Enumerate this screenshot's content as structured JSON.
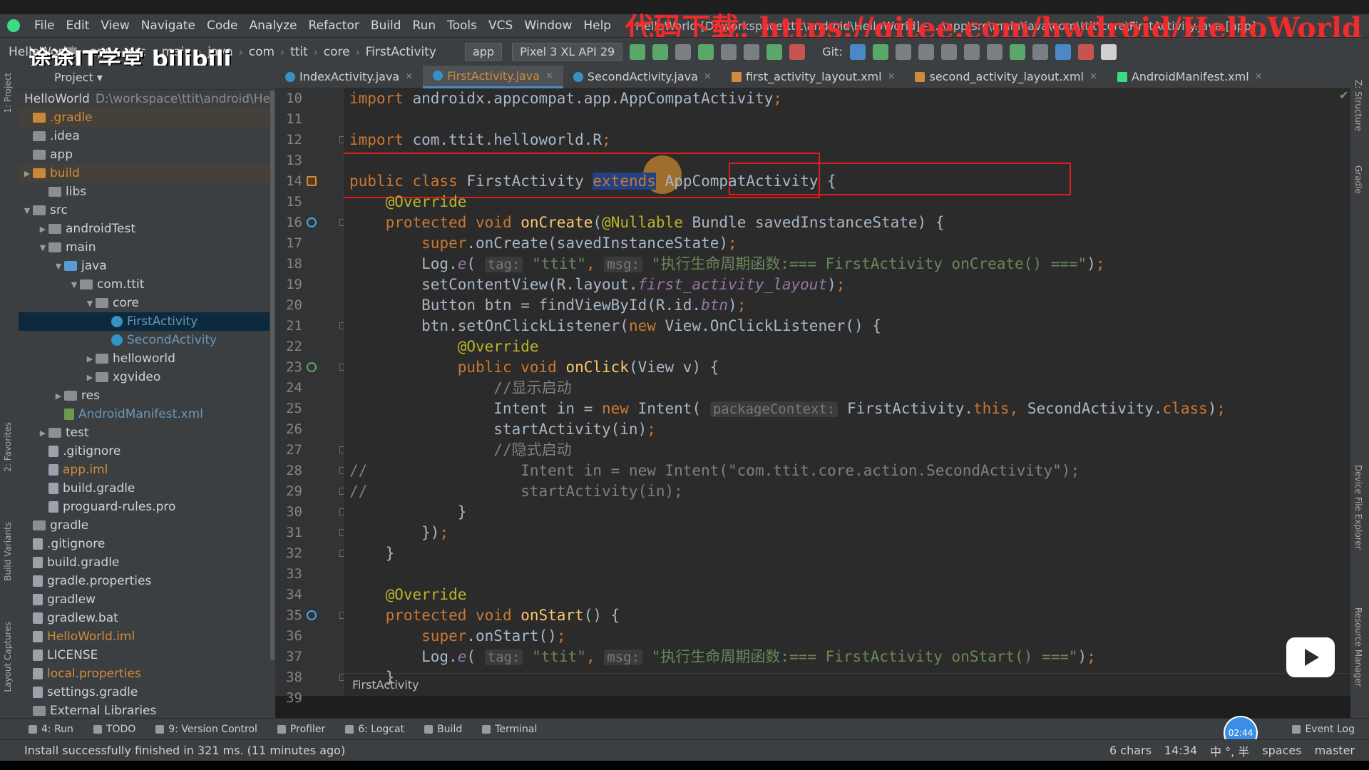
{
  "menu": {
    "items": [
      "File",
      "Edit",
      "View",
      "Navigate",
      "Code",
      "Analyze",
      "Refactor",
      "Build",
      "Run",
      "Tools",
      "VCS",
      "Window",
      "Help"
    ],
    "title": "HelloWorld [D:\\workspace\\ttit\\android\\HelloWorld] - ...\\app\\src\\main\\java\\com\\ttit\\core\\FirstActivity.java [app]"
  },
  "watermarks": {
    "url": "代码下载: https://gitee.com/hwdroid/HelloWorld",
    "brand": "途途IT学堂 bilibili"
  },
  "nav": {
    "crumbs": [
      "HelloWorld",
      "app",
      "src",
      "main",
      "java",
      "com",
      "ttit",
      "core",
      "FirstActivity"
    ],
    "run_config": "app",
    "device": "Pixel 3 XL API 29",
    "git_label": "Git:"
  },
  "project": {
    "header": "1: Project",
    "root_name": "HelloWorld",
    "root_path": "D:\\workspace\\ttit\\android\\HelloWorld",
    "tree": [
      {
        "label": ".gradle",
        "depth": 0,
        "arrow": "",
        "icon": "folder-orange",
        "color": "orange",
        "excluded": true
      },
      {
        "label": ".idea",
        "depth": 0,
        "arrow": "",
        "icon": "folder"
      },
      {
        "label": "app",
        "depth": 0,
        "arrow": "",
        "icon": "folder"
      },
      {
        "label": "build",
        "depth": 0,
        "arrow": "▶",
        "icon": "folder-orange",
        "color": "orange",
        "excluded": true
      },
      {
        "label": "libs",
        "depth": 1,
        "arrow": "",
        "icon": "folder"
      },
      {
        "label": "src",
        "depth": 0,
        "arrow": "▼",
        "icon": "folder"
      },
      {
        "label": "androidTest",
        "depth": 1,
        "arrow": "▶",
        "icon": "folder"
      },
      {
        "label": "main",
        "depth": 1,
        "arrow": "▼",
        "icon": "folder"
      },
      {
        "label": "java",
        "depth": 2,
        "arrow": "▼",
        "icon": "folder-blue"
      },
      {
        "label": "com.ttit",
        "depth": 3,
        "arrow": "▼",
        "icon": "folder"
      },
      {
        "label": "core",
        "depth": 4,
        "arrow": "▼",
        "icon": "folder"
      },
      {
        "label": "FirstActivity",
        "depth": 5,
        "arrow": "",
        "icon": "java",
        "color": "blue",
        "selected": true
      },
      {
        "label": "SecondActivity",
        "depth": 5,
        "arrow": "",
        "icon": "java",
        "color": "blue"
      },
      {
        "label": "helloworld",
        "depth": 4,
        "arrow": "▶",
        "icon": "folder"
      },
      {
        "label": "xgvideo",
        "depth": 4,
        "arrow": "▶",
        "icon": "folder"
      },
      {
        "label": "res",
        "depth": 2,
        "arrow": "▶",
        "icon": "folder"
      },
      {
        "label": "AndroidManifest.xml",
        "depth": 2,
        "arrow": "",
        "icon": "xml",
        "color": "blue"
      },
      {
        "label": "test",
        "depth": 1,
        "arrow": "▶",
        "icon": "folder"
      },
      {
        "label": ".gitignore",
        "depth": 1,
        "arrow": "",
        "icon": "file"
      },
      {
        "label": "app.iml",
        "depth": 1,
        "arrow": "",
        "icon": "file",
        "color": "orange"
      },
      {
        "label": "build.gradle",
        "depth": 1,
        "arrow": "",
        "icon": "file"
      },
      {
        "label": "proguard-rules.pro",
        "depth": 1,
        "arrow": "",
        "icon": "file"
      },
      {
        "label": "gradle",
        "depth": 0,
        "arrow": "",
        "icon": "folder"
      },
      {
        "label": ".gitignore",
        "depth": 0,
        "arrow": "",
        "icon": "file"
      },
      {
        "label": "build.gradle",
        "depth": 0,
        "arrow": "",
        "icon": "file"
      },
      {
        "label": "gradle.properties",
        "depth": 0,
        "arrow": "",
        "icon": "file"
      },
      {
        "label": "gradlew",
        "depth": 0,
        "arrow": "",
        "icon": "file"
      },
      {
        "label": "gradlew.bat",
        "depth": 0,
        "arrow": "",
        "icon": "file"
      },
      {
        "label": "HelloWorld.iml",
        "depth": 0,
        "arrow": "",
        "icon": "file",
        "color": "orange"
      },
      {
        "label": "LICENSE",
        "depth": 0,
        "arrow": "",
        "icon": "file"
      },
      {
        "label": "local.properties",
        "depth": 0,
        "arrow": "",
        "icon": "file",
        "color": "orange"
      },
      {
        "label": "settings.gradle",
        "depth": 0,
        "arrow": "",
        "icon": "file"
      },
      {
        "label": "External Libraries",
        "depth": 0,
        "arrow": "",
        "icon": "folder"
      }
    ]
  },
  "tabs": [
    {
      "label": "IndexActivity.java",
      "icon": "java",
      "active": false
    },
    {
      "label": "FirstActivity.java",
      "icon": "java",
      "active": true
    },
    {
      "label": "SecondActivity.java",
      "icon": "java",
      "active": false
    },
    {
      "label": "first_activity_layout.xml",
      "icon": "xml",
      "active": false
    },
    {
      "label": "second_activity_layout.xml",
      "icon": "xml",
      "active": false
    },
    {
      "label": "AndroidManifest.xml",
      "icon": "manifest",
      "active": false
    }
  ],
  "editor": {
    "line_numbers": [
      "10",
      "11",
      "12",
      "13",
      "14",
      "15",
      "16",
      "17",
      "18",
      "19",
      "20",
      "21",
      "22",
      "23",
      "24",
      "25",
      "26",
      "27",
      "28",
      "29",
      "30",
      "31",
      "32",
      "33",
      "34",
      "35",
      "36",
      "37",
      "38",
      "39"
    ],
    "lines": [
      [
        {
          "t": "import ",
          "c": "kw"
        },
        {
          "t": "androidx.appcompat.app.AppCompatActivity"
        },
        {
          "t": ";",
          "c": "kw"
        }
      ],
      [],
      [
        {
          "t": "import ",
          "c": "kw"
        },
        {
          "t": "com.ttit.helloworld.R"
        },
        {
          "t": ";",
          "c": "kw"
        }
      ],
      [],
      [
        {
          "t": "public class ",
          "c": "kw"
        },
        {
          "t": "FirstActivity "
        },
        {
          "t": "extends",
          "c": "sel"
        },
        {
          "t": " AppCompatActivity {"
        }
      ],
      [
        {
          "t": "    "
        },
        {
          "t": "@Override",
          "c": "an"
        }
      ],
      [
        {
          "t": "    "
        },
        {
          "t": "protected void ",
          "c": "kw"
        },
        {
          "t": "onCreate",
          "c": "fn"
        },
        {
          "t": "("
        },
        {
          "t": "@Nullable",
          "c": "an"
        },
        {
          "t": " Bundle savedInstanceState) {"
        }
      ],
      [
        {
          "t": "        "
        },
        {
          "t": "super",
          "c": "kw"
        },
        {
          "t": ".onCreate(savedInstanceState)"
        },
        {
          "t": ";",
          "c": "kw"
        }
      ],
      [
        {
          "t": "        Log."
        },
        {
          "t": "e",
          "c": "st"
        },
        {
          "t": "( "
        },
        {
          "t": "tag:",
          "c": "hint"
        },
        {
          "t": " "
        },
        {
          "t": "\"ttit\"",
          "c": "str"
        },
        {
          "t": ", ",
          "c": "kw"
        },
        {
          "t": "msg:",
          "c": "hint"
        },
        {
          "t": " "
        },
        {
          "t": "\"执行生命周期函数:=== FirstActivity onCreate() ===\"",
          "c": "str"
        },
        {
          "t": ")"
        },
        {
          "t": ";",
          "c": "kw"
        }
      ],
      [
        {
          "t": "        setContentView(R.layout."
        },
        {
          "t": "first_activity_layout",
          "c": "st"
        },
        {
          "t": ")"
        },
        {
          "t": ";",
          "c": "kw"
        }
      ],
      [
        {
          "t": "        Button btn = findViewById(R.id."
        },
        {
          "t": "btn",
          "c": "st"
        },
        {
          "t": ")"
        },
        {
          "t": ";",
          "c": "kw"
        }
      ],
      [
        {
          "t": "        btn.setOnClickListener("
        },
        {
          "t": "new ",
          "c": "kw"
        },
        {
          "t": "View.OnClickListener() {"
        }
      ],
      [
        {
          "t": "            "
        },
        {
          "t": "@Override",
          "c": "an"
        }
      ],
      [
        {
          "t": "            "
        },
        {
          "t": "public void ",
          "c": "kw"
        },
        {
          "t": "onClick",
          "c": "fn"
        },
        {
          "t": "(View v) {"
        }
      ],
      [
        {
          "t": "                "
        },
        {
          "t": "//显示启动",
          "c": "cm"
        }
      ],
      [
        {
          "t": "                Intent in = "
        },
        {
          "t": "new ",
          "c": "kw"
        },
        {
          "t": "Intent( "
        },
        {
          "t": "packageContext:",
          "c": "hint"
        },
        {
          "t": " FirstActivity."
        },
        {
          "t": "this",
          "c": "kw"
        },
        {
          "t": ", ",
          "c": "kw"
        },
        {
          "t": "SecondActivity."
        },
        {
          "t": "class",
          "c": "kw"
        },
        {
          "t": ")"
        },
        {
          "t": ";",
          "c": "kw"
        }
      ],
      [
        {
          "t": "                startActivity(in)"
        },
        {
          "t": ";",
          "c": "kw"
        }
      ],
      [
        {
          "t": "                "
        },
        {
          "t": "//隐式启动",
          "c": "cm"
        }
      ],
      [
        {
          "t": "//                 Intent in = new Intent(\"com.ttit.core.action.SecondActivity\");",
          "c": "cm"
        }
      ],
      [
        {
          "t": "//                 startActivity(in);",
          "c": "cm"
        }
      ],
      [
        {
          "t": "            }"
        }
      ],
      [
        {
          "t": "        })"
        },
        {
          "t": ";",
          "c": "kw"
        }
      ],
      [
        {
          "t": "    }"
        }
      ],
      [],
      [
        {
          "t": "    "
        },
        {
          "t": "@Override",
          "c": "an"
        }
      ],
      [
        {
          "t": "    "
        },
        {
          "t": "protected void ",
          "c": "kw"
        },
        {
          "t": "onStart",
          "c": "fn"
        },
        {
          "t": "() {"
        }
      ],
      [
        {
          "t": "        "
        },
        {
          "t": "super",
          "c": "kw"
        },
        {
          "t": ".onStart()"
        },
        {
          "t": ";",
          "c": "kw"
        }
      ],
      [
        {
          "t": "        Log."
        },
        {
          "t": "e",
          "c": "st"
        },
        {
          "t": "( "
        },
        {
          "t": "tag:",
          "c": "hint"
        },
        {
          "t": " "
        },
        {
          "t": "\"ttit\"",
          "c": "str"
        },
        {
          "t": ", ",
          "c": "kw"
        },
        {
          "t": "msg:",
          "c": "hint"
        },
        {
          "t": " "
        },
        {
          "t": "\"执行生命周期函数:=== FirstActivity onStart() ===\"",
          "c": "str"
        },
        {
          "t": ")"
        },
        {
          "t": ";",
          "c": "kw"
        }
      ],
      [
        {
          "t": "    }"
        }
      ],
      []
    ],
    "breadcrumb": "FirstActivity"
  },
  "bottom_tools": [
    "4: Run",
    "TODO",
    "9: Version Control",
    "Profiler",
    "6: Logcat",
    "Build",
    "Terminal"
  ],
  "event_log": "Event Log",
  "timer": "02:44",
  "status": {
    "message": "Install successfully finished in 321 ms. (11 minutes ago)",
    "chars": "6 chars",
    "position": "14:34",
    "ime": "中 °, 半",
    "indent": "spaces",
    "branch": "master"
  },
  "side_tools": {
    "left": [
      "2: Favorites",
      "Build Variants",
      "Layout Captures"
    ],
    "right": [
      "Z: Structure",
      "Gradle",
      "Device File Explorer",
      "Resource Manager"
    ]
  },
  "colors": {
    "accent": "#4a88c7",
    "keyword": "#cc7832",
    "string": "#6a8759",
    "annotation": "#bbb529",
    "method": "#ffc66d",
    "highlight_box": "#e01b1b"
  }
}
